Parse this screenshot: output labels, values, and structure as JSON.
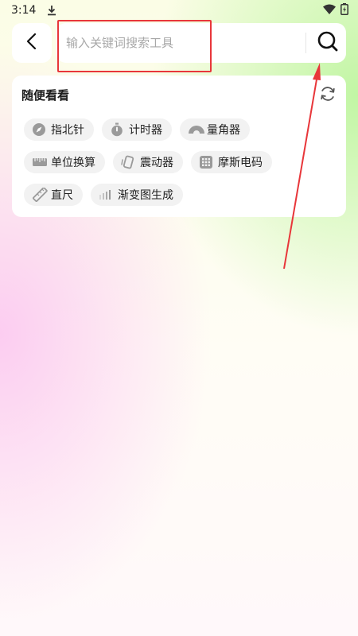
{
  "status_bar": {
    "time": "3:14"
  },
  "search": {
    "placeholder": "输入关键词搜索工具",
    "value": ""
  },
  "suggestions": {
    "title": "随便看看",
    "rows": [
      [
        {
          "label": "指北针",
          "icon": "compass-icon"
        },
        {
          "label": "计时器",
          "icon": "stopwatch-icon"
        },
        {
          "label": "量角器",
          "icon": "protractor-icon"
        }
      ],
      [
        {
          "label": "单位换算",
          "icon": "unit-convert-icon"
        },
        {
          "label": "震动器",
          "icon": "vibration-icon"
        },
        {
          "label": "摩斯电码",
          "icon": "keypad-icon"
        }
      ],
      [
        {
          "label": "直尺",
          "icon": "ruler-icon"
        },
        {
          "label": "渐变图生成",
          "icon": "gradient-bars-icon"
        }
      ]
    ]
  },
  "colors": {
    "annotation": "#e8363a",
    "chip_background": "#f2f2f2",
    "chip_icon": "#9a9a9a"
  }
}
